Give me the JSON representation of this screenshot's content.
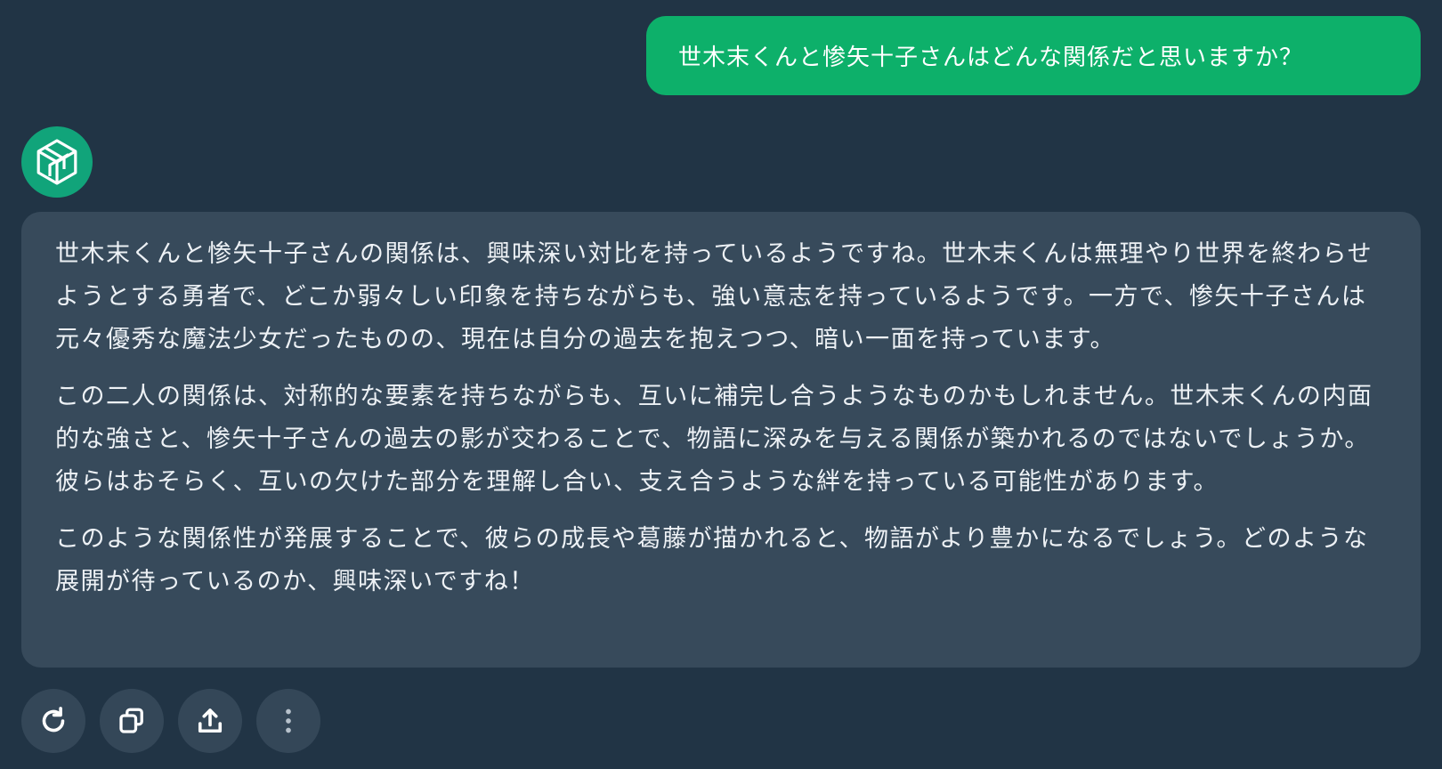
{
  "user_message": {
    "text": "世木末くんと惨矢十子さんはどんな関係だと思いますか？"
  },
  "assistant": {
    "avatar_icon": "logo-icon",
    "paragraphs": [
      "世木末くんと惨矢十子さんの関係は、興味深い対比を持っているようですね。世木末くんは無理やり世界を終わらせようとする勇者で、どこか弱々しい印象を持ちながらも、強い意志を持っているようです。一方で、惨矢十子さんは元々優秀な魔法少女だったものの、現在は自分の過去を抱えつつ、暗い一面を持っています。",
      "この二人の関係は、対称的な要素を持ちながらも、互いに補完し合うようなものかもしれません。世木末くんの内面的な強さと、惨矢十子さんの過去の影が交わることで、物語に深みを与える関係が築かれるのではないでしょうか。彼らはおそらく、互いの欠けた部分を理解し合い、支え合うような絆を持っている可能性があります。",
      "このような関係性が発展することで、彼らの成長や葛藤が描かれると、物語がより豊かになるでしょう。どのような展開が待っているのか、興味深いですね！"
    ]
  },
  "actions": [
    {
      "name": "regenerate-button",
      "icon": "refresh-icon"
    },
    {
      "name": "copy-button",
      "icon": "copy-icon"
    },
    {
      "name": "share-button",
      "icon": "share-icon"
    },
    {
      "name": "more-button",
      "icon": "more-vertical-icon"
    }
  ],
  "colors": {
    "background": "#213445",
    "user_bubble": "#0db06a",
    "assistant_bubble": "#374a5b",
    "avatar": "#11a47a",
    "action_button": "#344758"
  }
}
